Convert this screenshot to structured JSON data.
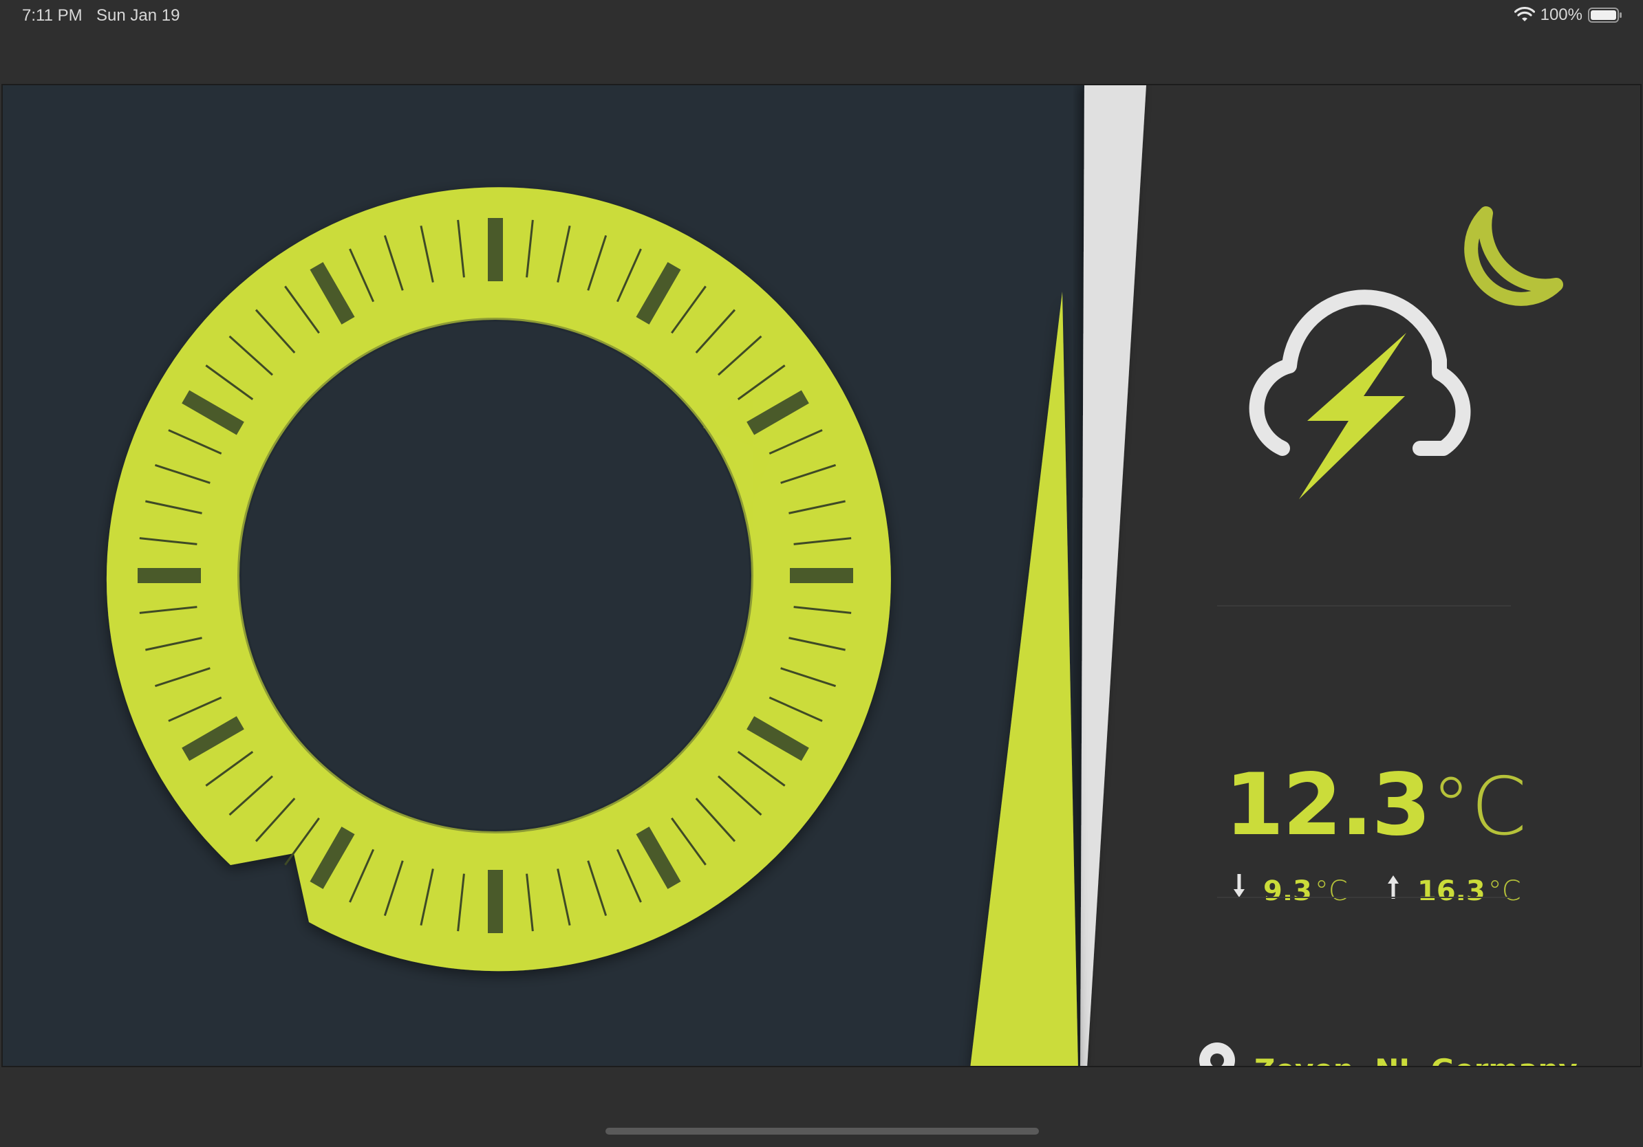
{
  "status_bar": {
    "time": "7:11 PM",
    "date": "Sun Jan 19",
    "battery_text": "100%",
    "icons": [
      "wifi-icon",
      "battery-icon"
    ]
  },
  "weather": {
    "condition_icon": "thunderstorm-night-icon",
    "temperature": "12.3",
    "temperature_unit": "°C",
    "min_temperature": "9.3",
    "max_temperature": "16.3",
    "unit": "°C"
  },
  "location": {
    "icon": "location-pin-icon",
    "name": "Zeven, NI, Germany"
  },
  "colors": {
    "accent": "#cbdc3a",
    "accent_dim": "#b6c23a",
    "panel_dark": "#2f2f2f",
    "dial_background": "#262f37",
    "tick_major": "#4a5a2a",
    "tick_minor": "#3f4a26",
    "stripe_light": "#e0e0e0"
  }
}
